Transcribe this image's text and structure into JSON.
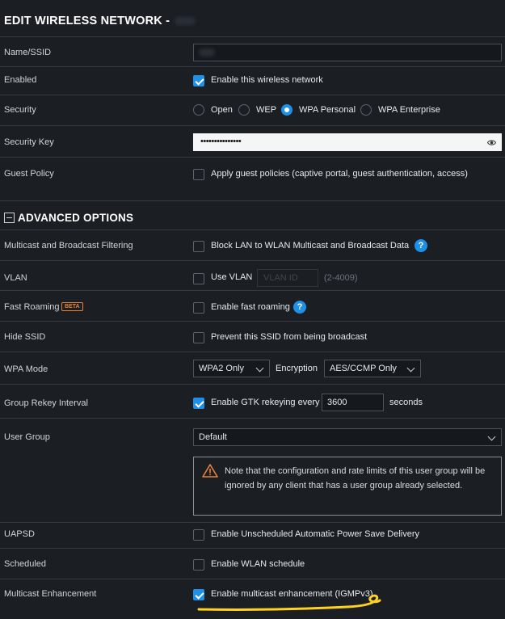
{
  "header": {
    "title": "EDIT WIRELESS NETWORK -"
  },
  "fields": {
    "name_label": "Name/SSID",
    "enabled_label": "Enabled",
    "enabled_text": "Enable this wireless network",
    "security_label": "Security",
    "security_options": [
      "Open",
      "WEP",
      "WPA Personal",
      "WPA Enterprise"
    ],
    "security_selected": "WPA Personal",
    "security_key_label": "Security Key",
    "security_key_value": "•••••••••••••••",
    "guest_label": "Guest Policy",
    "guest_text": "Apply guest policies (captive portal, guest authentication, access)"
  },
  "advanced": {
    "title": "ADVANCED OPTIONS",
    "multicast_label": "Multicast and Broadcast Filtering",
    "multicast_text": "Block LAN to WLAN Multicast and Broadcast Data",
    "vlan_label": "VLAN",
    "vlan_text": "Use VLAN",
    "vlan_placeholder": "VLAN ID",
    "vlan_range": "(2-4009)",
    "roaming_label": "Fast Roaming",
    "roaming_badge": "BETA",
    "roaming_text": "Enable fast roaming",
    "hide_label": "Hide SSID",
    "hide_text": "Prevent this SSID from being broadcast",
    "wpa_mode_label": "WPA Mode",
    "wpa_mode_value": "WPA2 Only",
    "encryption_label": "Encryption",
    "encryption_value": "AES/CCMP Only",
    "rekey_label": "Group Rekey Interval",
    "rekey_text": "Enable GTK rekeying every",
    "rekey_value": "3600",
    "rekey_unit": "seconds",
    "usergroup_label": "User Group",
    "usergroup_value": "Default",
    "warning_text": "Note that the configuration and rate limits of this user group will be ignored by any client that has a user group already selected.",
    "uapsd_label": "UAPSD",
    "uapsd_text": "Enable Unscheduled Automatic Power Save Delivery",
    "scheduled_label": "Scheduled",
    "scheduled_text": "Enable WLAN schedule",
    "mcast_enh_label": "Multicast Enhancement",
    "mcast_enh_text": "Enable multicast enhancement (IGMPv3)"
  },
  "icons": {
    "help": "?",
    "eye": "eye-icon",
    "warning": "warning-icon"
  },
  "colors": {
    "accent": "#1e90e8",
    "highlight": "#ffd21f",
    "beta": "#e8823a"
  }
}
